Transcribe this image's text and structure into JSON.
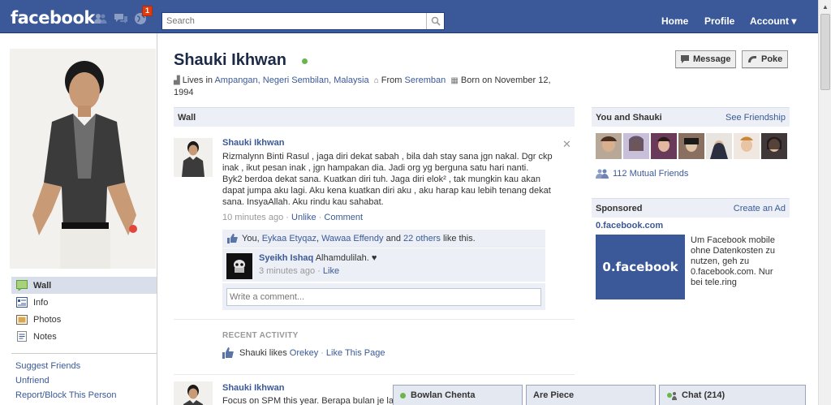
{
  "topbar": {
    "logo": "facebook",
    "notification_count": "1",
    "search_placeholder": "Search",
    "nav": {
      "home": "Home",
      "profile": "Profile",
      "account": "Account ▾"
    }
  },
  "profile": {
    "name": "Shauki Ikhwan",
    "buttons": {
      "message": "Message",
      "poke": "Poke"
    },
    "info": {
      "lives_prefix": "Lives in",
      "lives_place": "Ampangan, Negeri Sembilan, Malaysia",
      "from_prefix": "From",
      "from_place": "Seremban",
      "born": "Born on November 12, 1994"
    }
  },
  "leftnav": {
    "items": [
      {
        "label": "Wall"
      },
      {
        "label": "Info"
      },
      {
        "label": "Photos"
      },
      {
        "label": "Notes"
      }
    ],
    "links": [
      "Suggest Friends",
      "Unfriend",
      "Report/Block This Person"
    ]
  },
  "wall": {
    "tab": "Wall",
    "post1": {
      "author": "Shauki Ikhwan",
      "lines": [
        "Rizmalynn Binti Rasul , jaga diri dekat sabah , bila dah stay sana jgn nakal. Dgr ckp",
        "inak , ikut pesan inak , jgn hampakan dia. Jadi org yg berguna satu hari nanti.",
        "Byk2 berdoa dekat sana. Kuatkan diri tuh. Jaga diri elok² , tak mungkin kau akan",
        "dapat jumpa aku lagi. Aku kena kuatkan diri aku , aku harap kau lebih tenang dekat",
        "sana. InsyaAllah. Aku rindu kau sahabat."
      ],
      "time": "10 minutes ago",
      "sep": "·",
      "unlike": "Unlike",
      "comment": "Comment",
      "likes": {
        "you": "You,",
        "user1": "Eykaa Etyqaz",
        "comma": ",",
        "user2": "Wawaa Effendy",
        "and": "and",
        "others": "22 others",
        "suffix": "like this."
      },
      "reply": {
        "author": "Syeikh Ishaq",
        "text": "Alhamdulilah. ♥",
        "time": "3 minutes ago",
        "like": "Like"
      },
      "comment_placeholder": "Write a comment..."
    },
    "recent": {
      "title": "RECENT ACTIVITY",
      "text": "Shauki likes",
      "page": "Orekey",
      "action": "Like This Page"
    },
    "post2": {
      "author": "Shauki Ikhwan",
      "text": "Focus on SPM this year. Berapa bulan je lagi"
    }
  },
  "right": {
    "you_and": {
      "title": "You and Shauki",
      "link": "See Friendship"
    },
    "mutual": "112 Mutual Friends",
    "sponsored": {
      "title": "Sponsored",
      "link": "Create an Ad"
    },
    "ad": {
      "title": "0.facebook.com",
      "image_text": "0.facebook",
      "text": "Um Facebook mobile ohne Datenkosten zu nutzen, geh zu 0.facebook.com. Nur bei tele.ring"
    }
  },
  "chat": {
    "tab1": "Bowlan Chenta",
    "tab2": "Are Piece",
    "tab3": "Chat (214)"
  },
  "colors": {
    "brand": "#3b5998",
    "online": "#6ab54c"
  }
}
